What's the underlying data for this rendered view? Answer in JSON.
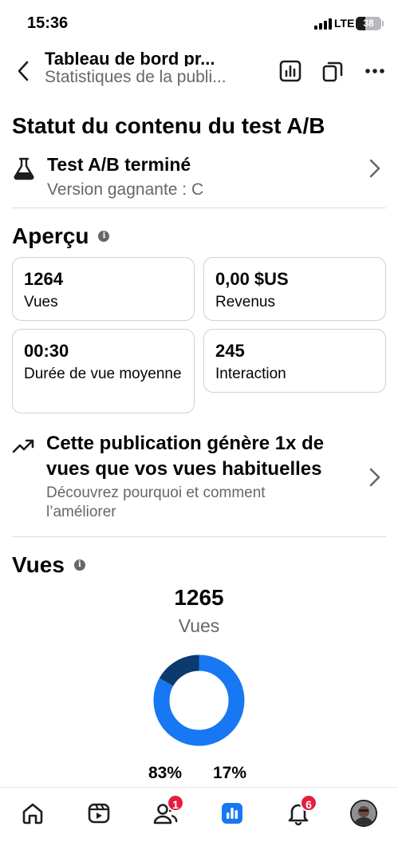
{
  "status_bar": {
    "time": "15:36",
    "network": "LTE",
    "battery_level": "38",
    "battery_fraction": 0.38
  },
  "nav": {
    "title": "Tableau de bord pr...",
    "subtitle": "Statistiques de la publi...",
    "icons": [
      "back-chevron-icon",
      "bar-chart-icon",
      "copy-icon",
      "more-icon"
    ]
  },
  "ab_section": {
    "heading": "Statut du contenu du test A/B",
    "status_title": "Test A/B terminé",
    "status_subtitle": "Version gagnante : C",
    "icon": "flask-icon"
  },
  "overview": {
    "heading": "Aperçu",
    "cards": [
      {
        "value": "1264",
        "label": "Vues"
      },
      {
        "value": "0,00 $US",
        "label": "Revenus"
      },
      {
        "value": "00:30",
        "label": "Durée de vue moyenne"
      },
      {
        "value": "245",
        "label": "Interaction"
      }
    ]
  },
  "insight": {
    "icon": "trending-up-icon",
    "title": "Cette publication génère 1x de vues que vos vues habituelles",
    "subtitle": "Découvrez pourquoi et comment l’améliorer"
  },
  "views": {
    "heading": "Vues",
    "total": "1265",
    "total_label": "Vues",
    "donut": {
      "segments": [
        {
          "percent": 83,
          "color": "#1877f2"
        },
        {
          "percent": 17,
          "color": "#0a3a6e"
        }
      ]
    },
    "tabs": [
      {
        "label": "83%",
        "selected": false
      },
      {
        "label": "17%",
        "selected": true
      }
    ]
  },
  "bottom_nav": {
    "items": [
      {
        "icon": "home-icon",
        "badge": ""
      },
      {
        "icon": "video-icon",
        "badge": ""
      },
      {
        "icon": "friends-icon",
        "badge": "1"
      },
      {
        "icon": "dashboard-icon",
        "badge": ""
      },
      {
        "icon": "bell-icon",
        "badge": "6"
      },
      {
        "icon": "profile-avatar",
        "badge": ""
      }
    ]
  },
  "colors": {
    "accent": "#1877f2",
    "accent_dark": "#0a3a6e",
    "badge": "#e41e3f",
    "secondary_text": "#65676b"
  }
}
